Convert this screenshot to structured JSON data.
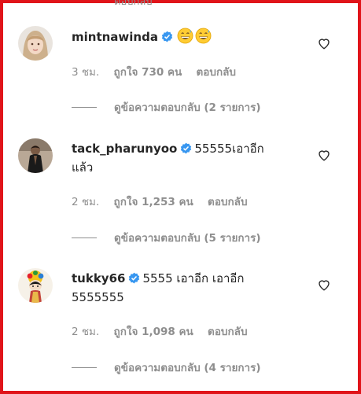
{
  "top_fragment": "ตอบกลับ",
  "comments": [
    {
      "username": "mintnawinda",
      "text": "",
      "emojis": [
        "grinning-sweat-emoji",
        "grinning-sweat-emoji"
      ],
      "time": "3 ชม.",
      "likes": "ถูกใจ 730 คน",
      "reply": "ตอบกลับ",
      "view_replies": "ดูข้อความตอบกลับ (2 รายการ)"
    },
    {
      "username": "tack_pharunyoo",
      "text": "55555เอาอีก",
      "text2": "แล้ว",
      "time": "2 ชม.",
      "likes": "ถูกใจ 1,253 คน",
      "reply": "ตอบกลับ",
      "view_replies": "ดูข้อความตอบกลับ (5 รายการ)"
    },
    {
      "username": "tukky66",
      "text": "5555 เอาอีก เอาอีก",
      "text2": "5555555",
      "time": "2 ชม.",
      "likes": "ถูกใจ 1,098 คน",
      "reply": "ตอบกลับ",
      "view_replies": "ดูข้อความตอบกลับ (4 รายการ)"
    }
  ],
  "colors": {
    "frame": "#e0141a",
    "verified": "#3897f0",
    "secondary_text": "#8e8e8e",
    "primary_text": "#262626"
  }
}
